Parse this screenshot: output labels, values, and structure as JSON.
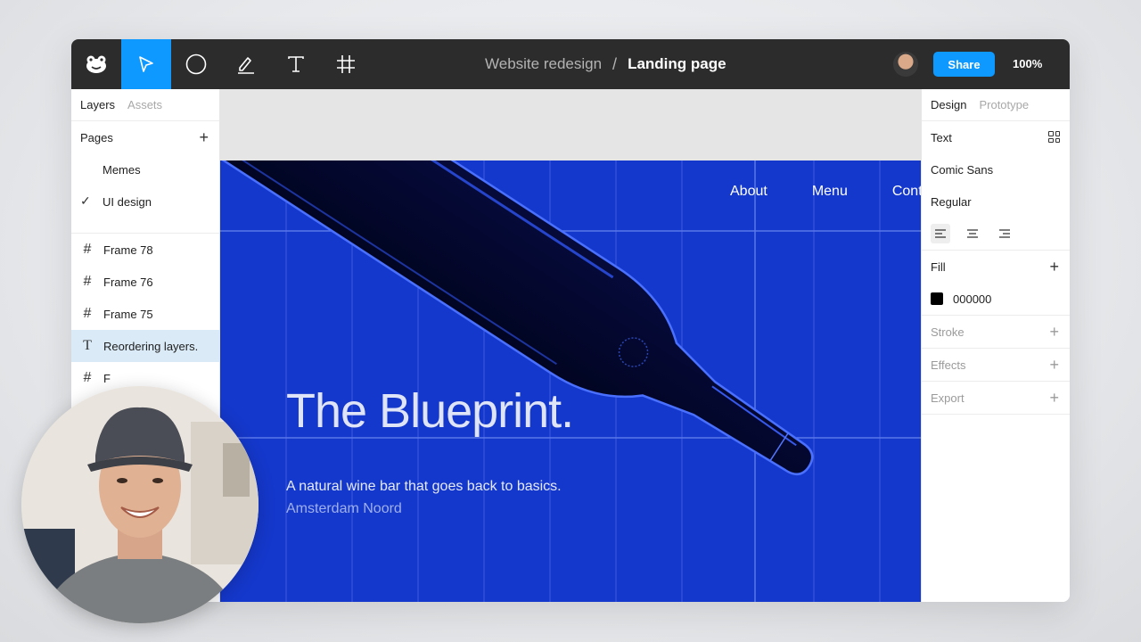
{
  "toolbar": {
    "tools": [
      {
        "name": "Main menu",
        "icon": "figma-logo-icon"
      },
      {
        "name": "Move",
        "icon": "cursor-arrow-icon",
        "active": true
      },
      {
        "name": "Ellipse",
        "icon": "circle-icon"
      },
      {
        "name": "Pen",
        "icon": "pen-icon"
      },
      {
        "name": "Text",
        "icon": "text-icon"
      },
      {
        "name": "Frame",
        "icon": "frame-hash-icon"
      }
    ],
    "breadcrumb": {
      "project": "Website redesign",
      "separator": "/",
      "page": "Landing page"
    },
    "share_label": "Share",
    "zoom": "100%",
    "accent": "#0d99ff"
  },
  "left_panel": {
    "tabs": {
      "active": "Layers",
      "inactive": "Assets"
    },
    "pages_heading": "Pages",
    "pages": [
      {
        "label": "Memes",
        "selected": false
      },
      {
        "label": "UI design",
        "selected": true
      }
    ],
    "layers": [
      {
        "label": "Frame 78",
        "icon": "frame-hash-icon"
      },
      {
        "label": "Frame 76",
        "icon": "frame-hash-icon"
      },
      {
        "label": "Frame 75",
        "icon": "frame-hash-icon"
      },
      {
        "label": "Reordering layers.",
        "icon": "text-icon",
        "selected": true
      },
      {
        "label": "F",
        "icon": "frame-hash-icon"
      }
    ]
  },
  "right_panel": {
    "tabs": {
      "active": "Design",
      "inactive": "Prototype"
    },
    "text_heading": "Text",
    "font_family": "Comic Sans",
    "font_weight": "Regular",
    "fill_heading": "Fill",
    "fill_hex": "000000",
    "stroke_heading": "Stroke",
    "effects_heading": "Effects",
    "export_heading": "Export"
  },
  "canvas": {
    "frame_color": "#1538cc",
    "nav": [
      "About",
      "Menu",
      "Cont"
    ],
    "hero_title": "The Blueprint.",
    "tagline": "A natural wine bar that goes back to basics.",
    "location": "Amsterdam Noord"
  }
}
